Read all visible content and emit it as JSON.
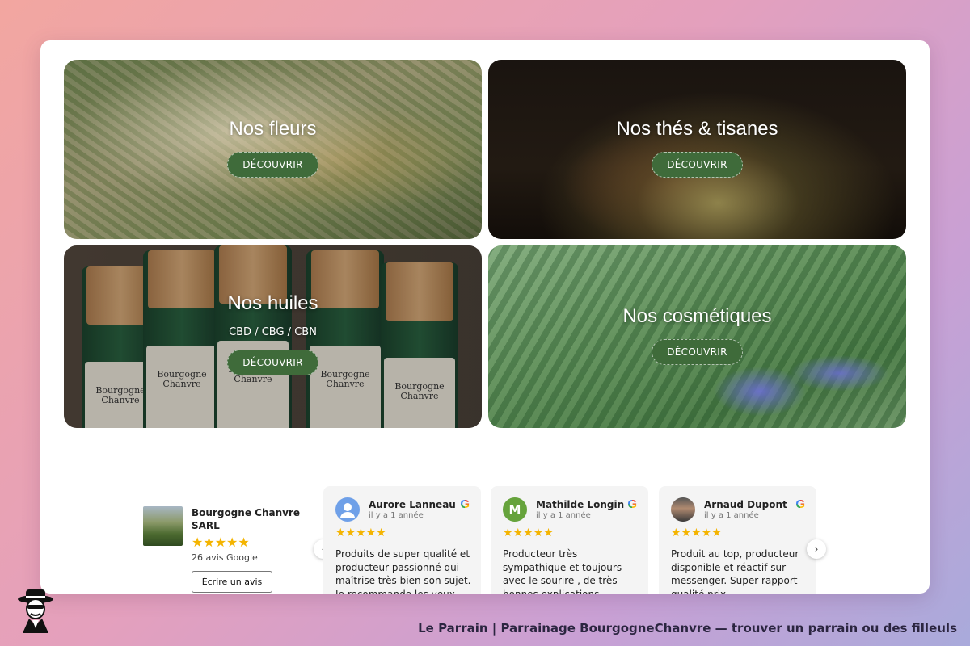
{
  "tiles": [
    {
      "title": "Nos fleurs",
      "button": "DÉCOUVRIR"
    },
    {
      "title": "Nos thés & tisanes",
      "button": "DÉCOUVRIR"
    },
    {
      "title": "Nos huiles",
      "subtitle": "CBD / CBG / CBN",
      "button": "DÉCOUVRIR",
      "bottle_brand": "Bourgogne Chanvre"
    },
    {
      "title": "Nos cosmétiques",
      "button": "DÉCOUVRIR"
    }
  ],
  "business": {
    "name": "Bourgogne Chanvre SARL",
    "stars": "★★★★★",
    "rating": 5,
    "review_count": "26 avis Google",
    "write_review": "Écrire un avis"
  },
  "reviews": [
    {
      "name": "Aurore Lanneau",
      "initial": "",
      "date": "il y a 1 année",
      "stars": "★★★★★",
      "text": "Produits de super qualité et producteur passionné qui maîtrise très bien son sujet. Je recommande les yeux"
    },
    {
      "name": "Mathilde Longin",
      "initial": "M",
      "date": "il y a 1 année",
      "stars": "★★★★★",
      "text": "Producteur très sympathique et toujours avec le sourire , de très bonnes explications"
    },
    {
      "name": "Arnaud Dupont",
      "initial": "",
      "date": "il y a 1 année",
      "stars": "★★★★★",
      "text": "Produit au top, producteur disponible et réactif sur messenger. Super rapport qualité prix"
    }
  ],
  "icons": {
    "google": "G",
    "prev": "‹",
    "next": "›"
  },
  "colors": {
    "accent_button": "#3f6b3a",
    "star": "#f4b400"
  },
  "footer": {
    "text": "Le Parrain | Parrainage BourgogneChanvre — trouver un parrain ou des filleuls"
  }
}
